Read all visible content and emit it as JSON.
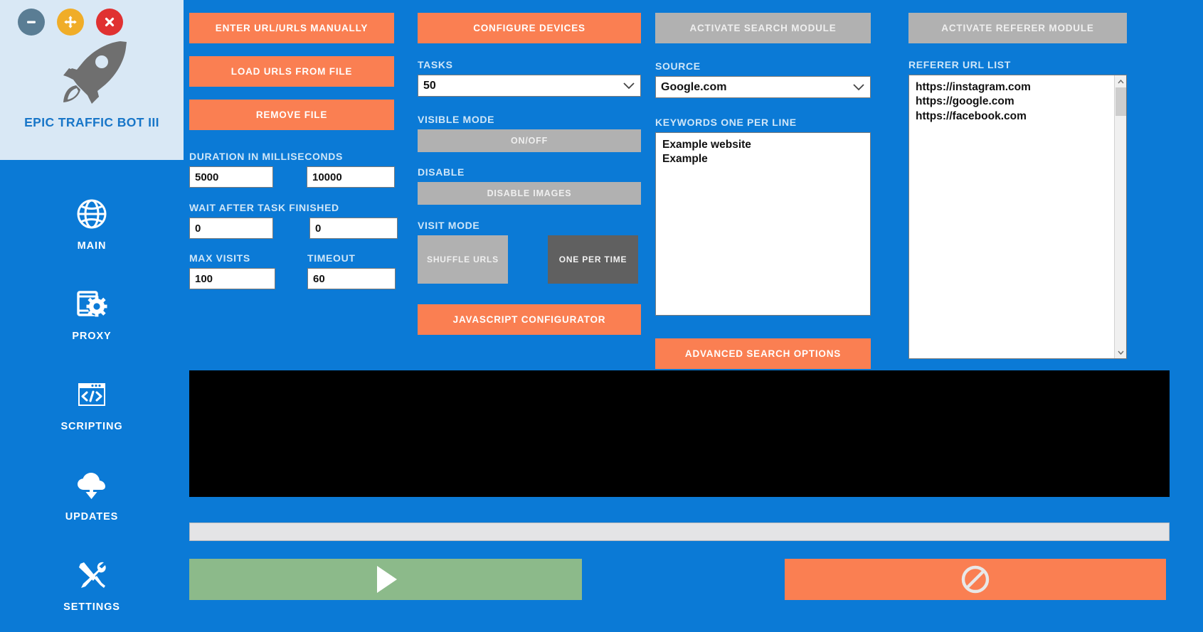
{
  "app": {
    "title": "EPIC TRAFFIC BOT III",
    "logo_icon": "rocket-icon",
    "window_controls": [
      {
        "name": "minimize",
        "icon": "minus-icon",
        "color": "#5a7d94"
      },
      {
        "name": "move",
        "icon": "move-arrows-icon",
        "color": "#f0ad28"
      },
      {
        "name": "close",
        "icon": "close-x-icon",
        "color": "#e03131"
      }
    ]
  },
  "sidebar": {
    "items": [
      {
        "label": "MAIN",
        "icon": "globe-icon"
      },
      {
        "label": "PROXY",
        "icon": "device-gear-icon"
      },
      {
        "label": "SCRIPTING",
        "icon": "code-window-icon"
      },
      {
        "label": "UPDATES",
        "icon": "cloud-download-icon"
      },
      {
        "label": "SETTINGS",
        "icon": "wrench-screwdriver-icon"
      }
    ]
  },
  "urls_column": {
    "enter_manually_label": "ENTER URL/URLS MANUALLY",
    "load_from_file_label": "LOAD URLS FROM FILE",
    "remove_file_label": "REMOVE FILE",
    "duration_label": "DURATION IN MILLISECONDS",
    "duration_min": "5000",
    "duration_max": "10000",
    "wait_label": "WAIT AFTER TASK FINISHED",
    "wait_min": "0",
    "wait_max": "0",
    "max_visits_label": "MAX VISITS",
    "max_visits_value": "100",
    "timeout_label": "TIMEOUT",
    "timeout_value": "60"
  },
  "tasks_column": {
    "configure_devices_label": "CONFIGURE DEVICES",
    "tasks_label": "TASKS",
    "tasks_value": "50",
    "visible_mode_label": "VISIBLE MODE",
    "visible_mode_button": "ON/OFF",
    "disable_label": "DISABLE",
    "disable_images_button": "DISABLE IMAGES",
    "visit_mode_label": "VISIT MODE",
    "shuffle_urls_button": "SHUFFLE URLS",
    "one_per_time_button": "ONE PER TIME",
    "javascript_configurator_label": "JAVASCRIPT CONFIGURATOR"
  },
  "search_column": {
    "activate_label": "ACTIVATE SEARCH MODULE",
    "source_label": "SOURCE",
    "source_value": "Google.com",
    "keywords_label": "KEYWORDS ONE PER LINE",
    "keywords_value": "Example website\nExample",
    "advanced_options_label": "ADVANCED SEARCH OPTIONS"
  },
  "referer_column": {
    "activate_label": "ACTIVATE REFERER MODULE",
    "list_label": "REFERER URL LIST",
    "urls": [
      "https://instagram.com",
      "https://google.com",
      "https://facebook.com"
    ]
  },
  "footer": {
    "start_icon": "play-triangle-icon",
    "stop_icon": "prohibition-circle-icon"
  },
  "colors": {
    "background_blue": "#0b7ad6",
    "accent_orange": "#fa7f52",
    "grey_button": "#b1b1b1",
    "grey_button_selected": "#606060",
    "start_green": "#8cba8a",
    "brand_panel": "#d9e8f5",
    "brand_text": "#1876c8",
    "label_text": "#cfe6f8"
  }
}
